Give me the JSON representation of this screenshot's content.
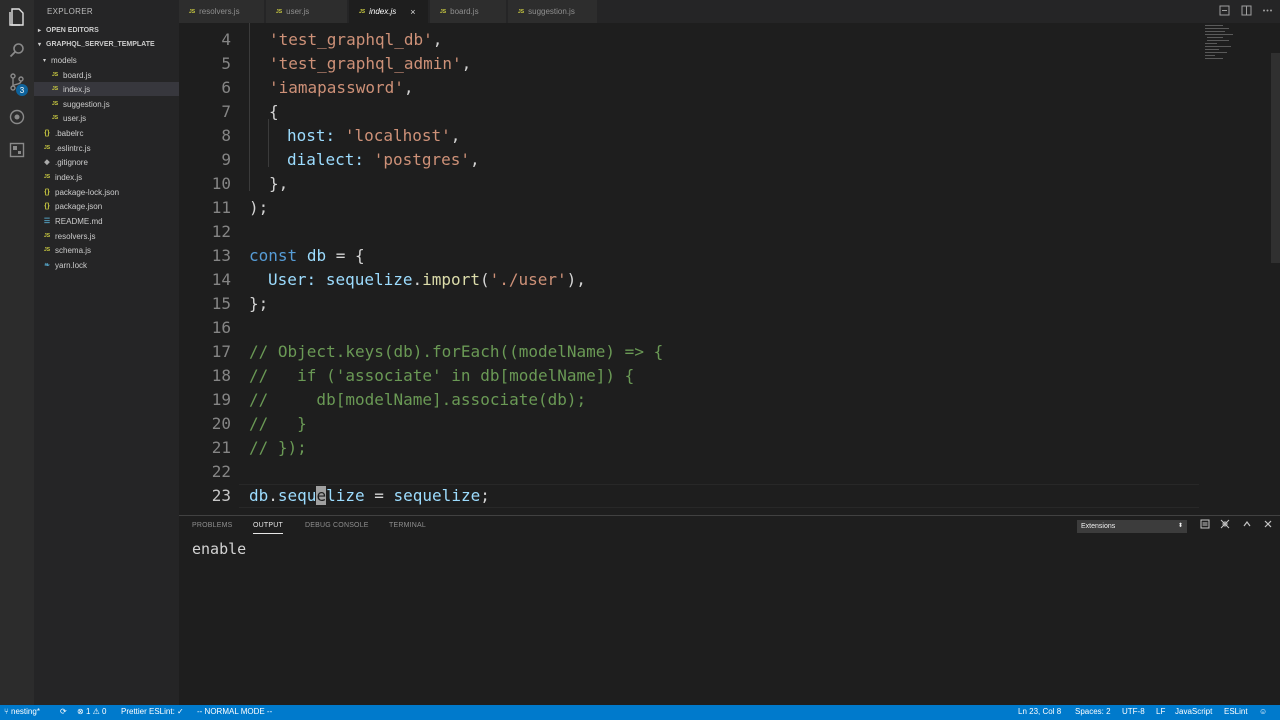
{
  "activity_bar": {
    "icons": [
      "files-icon",
      "search-icon",
      "source-control-icon",
      "debug-icon",
      "extensions-icon"
    ],
    "scm_badge": "3"
  },
  "sidebar": {
    "title": "EXPLORER",
    "open_editors": "OPEN EDITORS",
    "project": "GRAPHQL_SERVER_TEMPLATE",
    "folder_models": "models",
    "items": [
      {
        "label": "board.js",
        "icon": "JS"
      },
      {
        "label": "index.js",
        "icon": "JS"
      },
      {
        "label": "suggestion.js",
        "icon": "JS"
      },
      {
        "label": "user.js",
        "icon": "JS"
      },
      {
        "label": ".babelrc",
        "icon": "{}"
      },
      {
        "label": ".eslintrc.js",
        "icon": "JS"
      },
      {
        "label": ".gitignore",
        "icon": "◆"
      },
      {
        "label": "index.js",
        "icon": "JS"
      },
      {
        "label": "package-lock.json",
        "icon": "{}"
      },
      {
        "label": "package.json",
        "icon": "{}"
      },
      {
        "label": "README.md",
        "icon": "☰"
      },
      {
        "label": "resolvers.js",
        "icon": "JS"
      },
      {
        "label": "schema.js",
        "icon": "JS"
      },
      {
        "label": "yarn.lock",
        "icon": "❧"
      }
    ]
  },
  "tabs": [
    {
      "label": "resolvers.js",
      "active": false
    },
    {
      "label": "user.js",
      "active": false
    },
    {
      "label": "index.js",
      "active": true
    },
    {
      "label": "board.js",
      "active": false
    },
    {
      "label": "suggestion.js",
      "active": false
    }
  ],
  "tab_js_badge": "JS",
  "tab_close": "×",
  "editor": {
    "line_numbers": [
      "4",
      "5",
      "6",
      "7",
      "8",
      "9",
      "10",
      "11",
      "12",
      "13",
      "14",
      "15",
      "16",
      "17",
      "18",
      "19",
      "20",
      "21",
      "22",
      "23"
    ],
    "lines": {
      "l4": "'test_graphql_db'",
      "l5": "'test_graphql_admin'",
      "l6": "'iamapassword'",
      "l8_key": "host:",
      "l8_val": "'localhost'",
      "l9_key": "dialect:",
      "l9_val": "'postgres'",
      "l13_kw": "const",
      "l13_var": "db",
      "l14_key": "User:",
      "l14_obj": "sequelize",
      "l14_fn": "import",
      "l14_str": "'./user'",
      "l17": "// Object.keys(db).forEach((modelName) => {",
      "l18": "//   if ('associate' in db[modelName]) {",
      "l19": "//     db[modelName].associate(db);",
      "l20": "//   }",
      "l21": "// });",
      "l23_obj": "db",
      "l23_prop_a": "sequ",
      "l23_prop_cursor": "e",
      "l23_prop_b": "lize",
      "l23_rhs": "sequelize"
    }
  },
  "panel": {
    "tabs": [
      "PROBLEMS",
      "OUTPUT",
      "DEBUG CONSOLE",
      "TERMINAL"
    ],
    "active_tab": "OUTPUT",
    "channel": "Extensions",
    "output": "enable"
  },
  "status_bar": {
    "branch": "nesting*",
    "errors": "1",
    "warnings": "0",
    "prettier": "Prettier ESLint: ✓",
    "mode": "-- NORMAL MODE --",
    "position": "Ln 23, Col 8",
    "spaces": "Spaces: 2",
    "encoding": "UTF-8",
    "eol": "LF",
    "language": "JavaScript",
    "linter": "ESLint"
  }
}
